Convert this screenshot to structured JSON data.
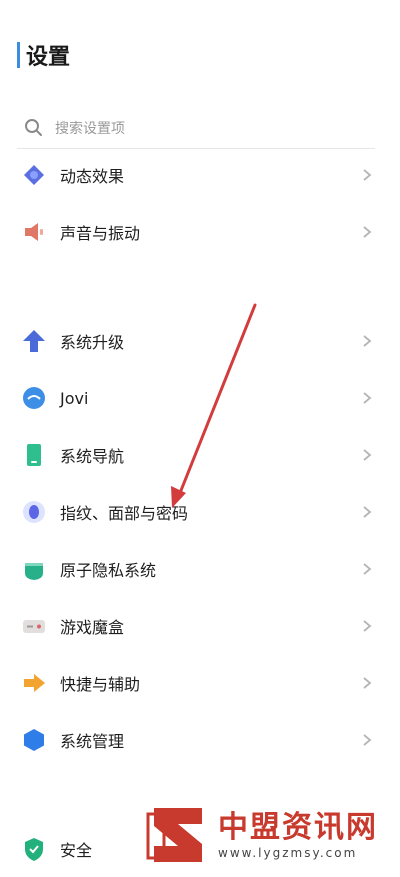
{
  "header": {
    "title": "设置"
  },
  "search": {
    "placeholder": "搜索设置项"
  },
  "items": [
    {
      "label": "动态效果",
      "icon": "motion-effects-icon"
    },
    {
      "label": "声音与振动",
      "icon": "speaker-icon"
    },
    {
      "label": "系统升级",
      "icon": "up-arrow-icon"
    },
    {
      "label": "Jovi",
      "icon": "jovi-icon"
    },
    {
      "label": "系统导航",
      "icon": "phone-navigation-icon"
    },
    {
      "label": "指纹、面部与密码",
      "icon": "fingerprint-icon"
    },
    {
      "label": "原子隐私系统",
      "icon": "privacy-icon"
    },
    {
      "label": "游戏魔盒",
      "icon": "game-box-icon"
    },
    {
      "label": "快捷与辅助",
      "icon": "shortcut-icon"
    },
    {
      "label": "系统管理",
      "icon": "system-management-icon"
    },
    {
      "label": "安全",
      "icon": "security-shield-icon"
    }
  ],
  "watermark": {
    "name": "中盟资讯网",
    "url": "www.lygzmsy.com"
  },
  "colors": {
    "accent": "#3b8de0",
    "arrow": "#d23c3c",
    "watermark": "#c73a2d"
  }
}
